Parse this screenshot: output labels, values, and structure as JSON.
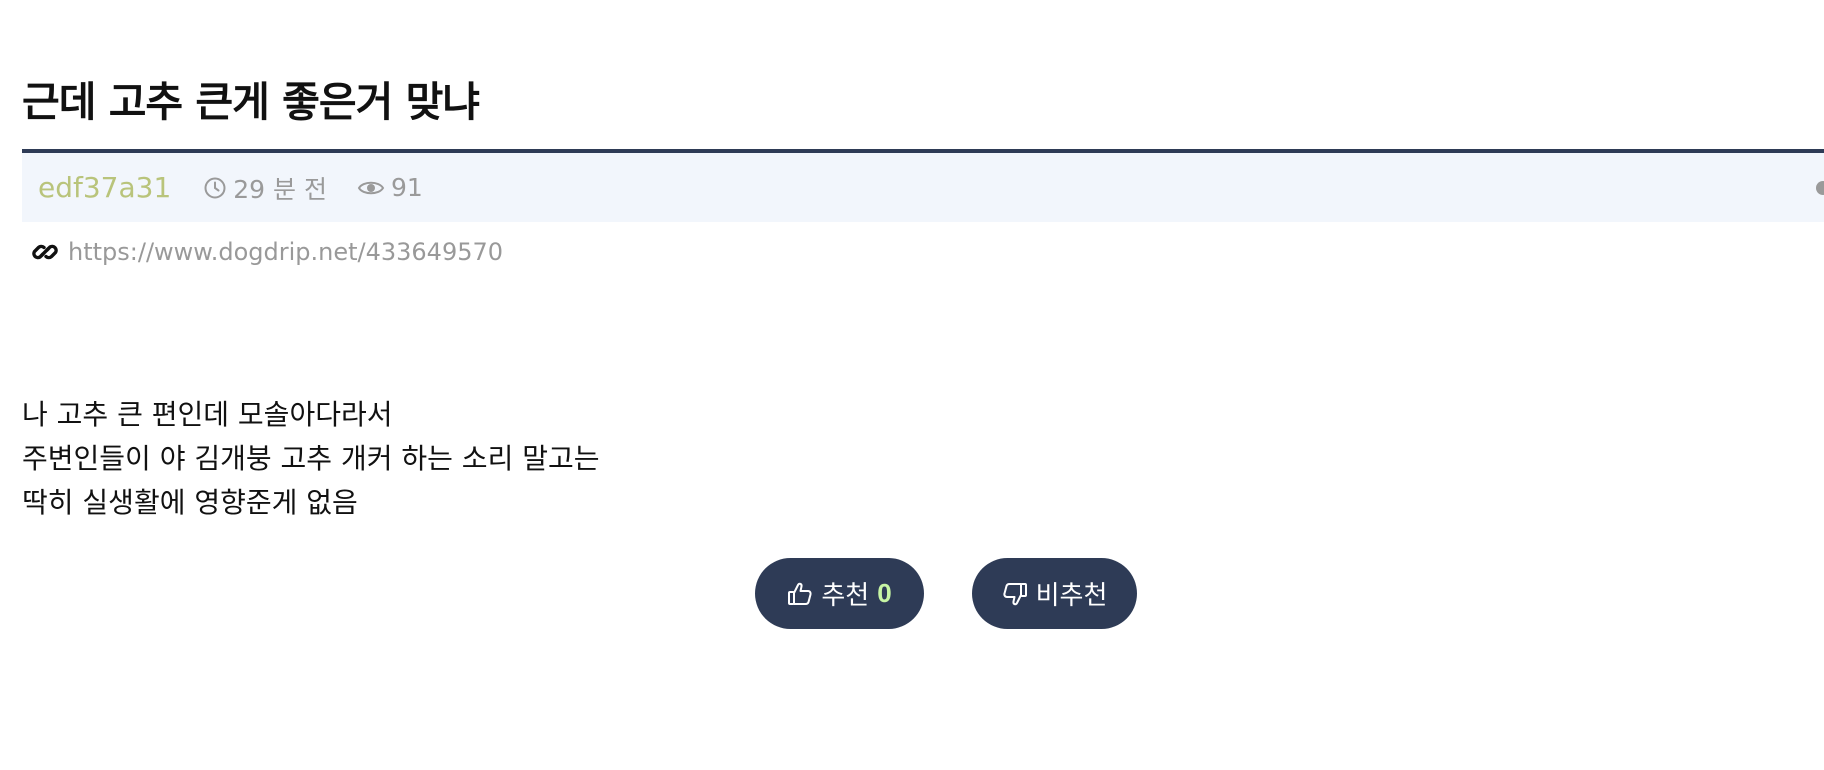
{
  "post": {
    "title": "근데 고추 큰게 좋은거 맞냐"
  },
  "meta": {
    "author": "edf37a31",
    "time": "29 분 전",
    "views": "91"
  },
  "link": {
    "url": "https://www.dogdrip.net/433649570"
  },
  "content": {
    "lines": [
      "나 고추 큰 편인데 모솔아다라서",
      "주변인들이 야 김개붕 고추 개커 하는 소리 말고는",
      "딱히 실생활에 영향준게 없음"
    ]
  },
  "votes": {
    "up_label": "추천",
    "up_count": "0",
    "down_label": "비추천"
  },
  "colors": {
    "accent_navy": "#2e3b56",
    "author_color": "#b9c47b",
    "meta_bg": "#f2f6fc",
    "vote_count_color": "#c7f5a4"
  },
  "icons": {
    "time": "clock-icon",
    "views": "eye-icon",
    "link": "link-icon",
    "up": "thumbs-up-icon",
    "down": "thumbs-down-icon"
  }
}
